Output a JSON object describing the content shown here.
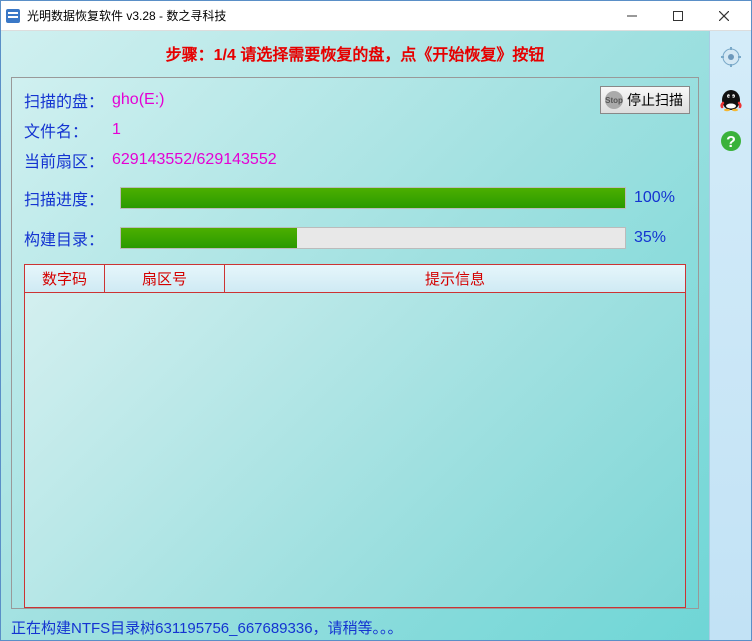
{
  "window": {
    "title": "光明数据恢复软件 v3.28 - 数之寻科技"
  },
  "header": {
    "step_text": "步骤：1/4 请选择需要恢复的盘，点《开始恢复》按钮"
  },
  "stop_button": {
    "label": "停止扫描",
    "icon_text": "Stop"
  },
  "info": {
    "disk_label": "扫描的盘：",
    "disk_value": "gho(E:)",
    "filename_label": "文件名：",
    "filename_value": "1",
    "sector_label": "当前扇区：",
    "sector_value": "629143552/629143552"
  },
  "progress_scan": {
    "label": "扫描进度：",
    "percent": 100,
    "percent_text": "100%"
  },
  "progress_build": {
    "label": "构建目录：",
    "percent": 35,
    "percent_text": "35%"
  },
  "table": {
    "columns": [
      "数字码",
      "扇区号",
      "提示信息"
    ],
    "rows": []
  },
  "status_bar": {
    "text": "正在构建NTFS目录树631195756_667689336，请稍等。。。"
  }
}
